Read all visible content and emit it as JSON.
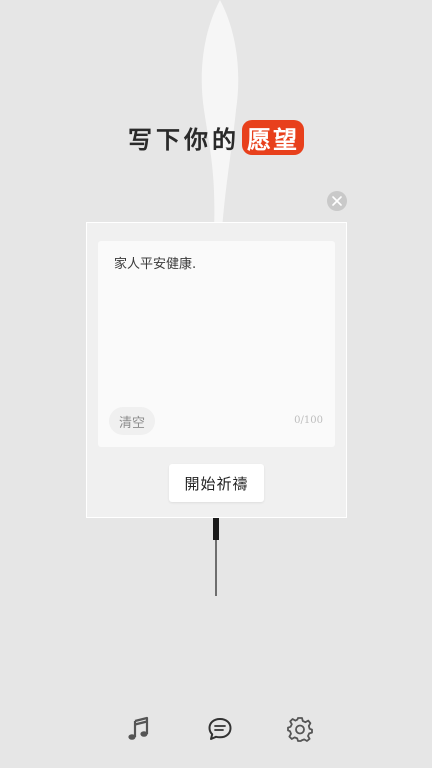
{
  "header": {
    "title_prefix": "写下你的",
    "title_highlight": "愿望"
  },
  "wish_form": {
    "text": "家人平安健康.",
    "clear_label": "清空",
    "counter": "0/100",
    "submit_label": "開始祈禱"
  },
  "colors": {
    "background": "#e6e6e6",
    "accent": "#e8401c"
  },
  "icons": {
    "close": "close-icon",
    "incense": "incense-stick",
    "nav": [
      "music-icon",
      "chat-icon",
      "gear-icon"
    ]
  }
}
